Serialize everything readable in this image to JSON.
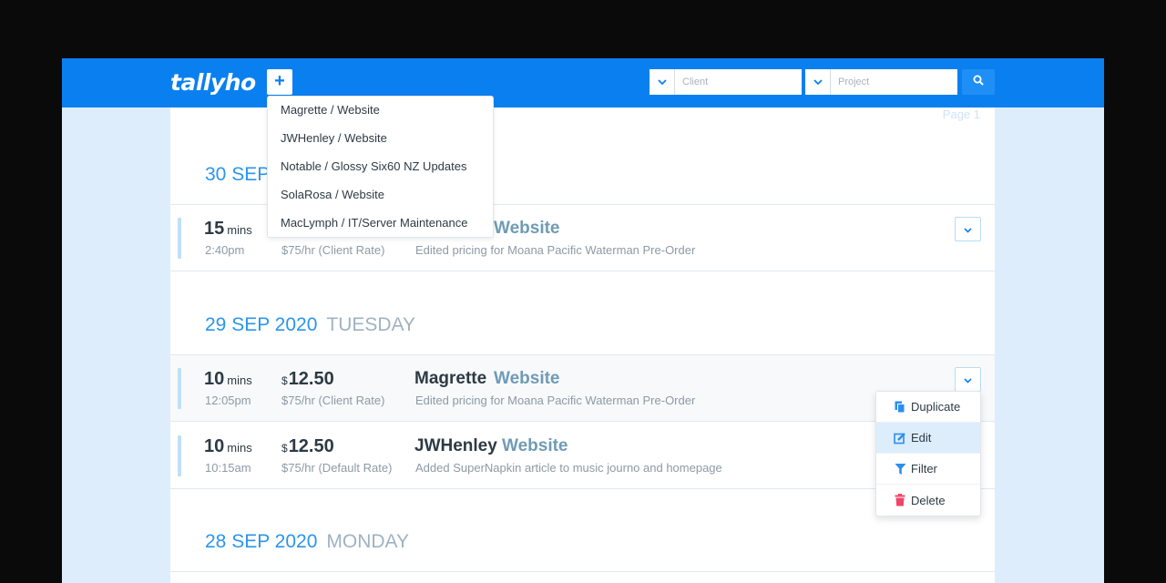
{
  "app": {
    "logo": "tallyho",
    "add_label": "+"
  },
  "filters": {
    "client_placeholder": "Client",
    "project_placeholder": "Project"
  },
  "page_label": "Page 1",
  "quick_add_menu": {
    "items": [
      "Magrette / Website",
      "JWHenley / Website",
      "Notable / Glossy Six60 NZ Updates",
      "SolaRosa / Website",
      "MacLymph / IT/Server Maintenance"
    ]
  },
  "days": [
    {
      "date": "30 SEP",
      "weekday": "",
      "entries": [
        {
          "mins": "15",
          "unit": "mins",
          "time": "2:40pm",
          "currency": "",
          "amount": "",
          "rate": "$75/hr (Client Rate)",
          "client": "",
          "project": "Website",
          "description": "Edited pricing for Moana Pacific Waterman Pre-Order"
        }
      ]
    },
    {
      "date": "29 SEP 2020",
      "weekday": "TUESDAY",
      "entries": [
        {
          "mins": "10",
          "unit": "mins",
          "time": "12:05pm",
          "currency": "$",
          "amount": "12.50",
          "rate": "$75/hr (Client Rate)",
          "client": "Magrette",
          "project": "Website",
          "description": "Edited pricing for Moana Pacific Waterman Pre-Order"
        },
        {
          "mins": "10",
          "unit": "mins",
          "time": "10:15am",
          "currency": "$",
          "amount": "12.50",
          "rate": "$75/hr (Default Rate)",
          "client": "JWHenley",
          "project": "Website",
          "description": "Added SuperNapkin article to music journo and homepage"
        }
      ]
    },
    {
      "date": "28 SEP 2020",
      "weekday": "MONDAY",
      "entries": []
    }
  ],
  "context_menu": {
    "items": [
      {
        "label": "Duplicate",
        "icon": "copy-icon",
        "color": "#2b8ff0"
      },
      {
        "label": "Edit",
        "icon": "edit-icon",
        "color": "#2b8ff0"
      },
      {
        "label": "Filter",
        "icon": "filter-icon",
        "color": "#2b8ff0"
      },
      {
        "label": "Delete",
        "icon": "trash-icon",
        "color": "#f0456a"
      }
    ]
  },
  "colors": {
    "brand": "#0a80f0",
    "accent": "#2b95ec",
    "background": "#ddedfc",
    "danger": "#f0456a"
  }
}
